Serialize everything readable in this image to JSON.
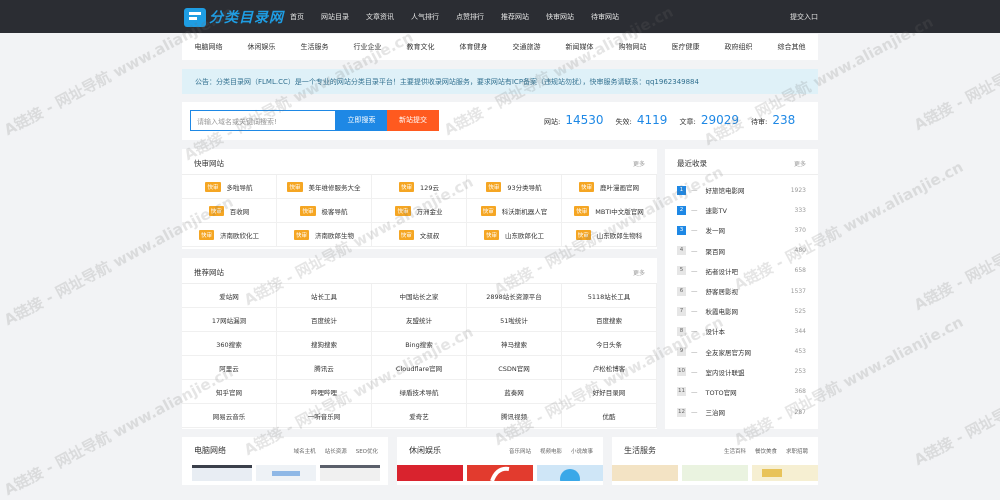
{
  "logo": {
    "text": "分类目录网"
  },
  "topnav": [
    "首页",
    "网站目录",
    "文章资讯",
    "人气排行",
    "点赞排行",
    "推荐网站",
    "快审网站",
    "待审网站"
  ],
  "submit": "提交入口",
  "categories": [
    "电脑网络",
    "休闲娱乐",
    "生活服务",
    "行业企业",
    "教育文化",
    "体育健身",
    "交通旅游",
    "新闻媒体",
    "购物网站",
    "医疗健康",
    "政府组织",
    "综合其他"
  ],
  "notice": "公告：分类目录网（FLML.CC）是一个专业的网站分类目录平台！主要提供收录网站服务，要求网站有ICP备案（违规站勿扰），快审服务请联系：qq1962349884",
  "search": {
    "placeholder": "请输入域名或关键词搜索!",
    "search_btn": "立即搜索",
    "submit_btn": "新站提交"
  },
  "stats": [
    {
      "label": "网站:",
      "value": "14530"
    },
    {
      "label": "失效:",
      "value": "4119"
    },
    {
      "label": "文章:",
      "value": "29029"
    },
    {
      "label": "待审:",
      "value": "238"
    }
  ],
  "fast": {
    "title": "快审网站",
    "more": "更多",
    "tag": "快审",
    "items": [
      "多啦导航",
      "美年维修服务大全",
      "129云",
      "93分类导航",
      "鹿叶漫画官网",
      "百收网",
      "极客导航",
      "万洲金业",
      "科沃斯机器人官",
      "MBTI中文版官网",
      "济南欧欣化工",
      "济南欧郎生物",
      "文叔叔",
      "山东欧郎化工",
      "山东欧郎生物科"
    ]
  },
  "recent": {
    "title": "最近收录",
    "more": "更多",
    "items": [
      {
        "num": "1",
        "name": "好旅馆电影网",
        "count": "1923"
      },
      {
        "num": "2",
        "name": "速影TV",
        "count": "333"
      },
      {
        "num": "3",
        "name": "发一网",
        "count": "370"
      },
      {
        "num": "4",
        "name": "聚百网",
        "count": "480"
      },
      {
        "num": "5",
        "name": "拓者设计吧",
        "count": "658"
      },
      {
        "num": "6",
        "name": "舒客居影视",
        "count": "1537"
      },
      {
        "num": "7",
        "name": "秋霞电影网",
        "count": "525"
      },
      {
        "num": "8",
        "name": "设计本",
        "count": "344"
      },
      {
        "num": "9",
        "name": "全友家居官方网",
        "count": "453"
      },
      {
        "num": "10",
        "name": "室内设计联盟",
        "count": "253"
      },
      {
        "num": "11",
        "name": "TOTO官网",
        "count": "368"
      },
      {
        "num": "12",
        "name": "三治网",
        "count": "287"
      }
    ]
  },
  "recommend": {
    "title": "推荐网站",
    "more": "更多",
    "items": [
      "爱站网",
      "站长工具",
      "中国站长之家",
      "2898站长资源平台",
      "5118站长工具",
      "17网站漏洞",
      "百度统计",
      "友盟统计",
      "51啦统计",
      "百度搜索",
      "360搜索",
      "搜狗搜索",
      "Bing搜索",
      "神马搜索",
      "今日头条",
      "阿里云",
      "腾讯云",
      "Cloudflare官网",
      "CSDN官网",
      "卢松松博客",
      "知乎官网",
      "哔哩哔哩",
      "绿盾技术导航",
      "蓝奏网",
      "好好目录网",
      "网易云音乐",
      "一听音乐网",
      "爱奇艺",
      "腾讯视频",
      "优酷"
    ]
  },
  "bottom": [
    {
      "title": "电脑网络",
      "links": [
        "域名主机",
        "站长资源",
        "SEO优化"
      ]
    },
    {
      "title": "休闲娱乐",
      "links": [
        "音乐网站",
        "视频电影",
        "小说故事"
      ]
    },
    {
      "title": "生活服务",
      "links": [
        "生活百科",
        "餐饮美食",
        "求职招聘"
      ]
    }
  ],
  "watermark": "A链接 - 网址导航 www.alianjie.cn",
  "colors": {
    "accent": "#1e88e5",
    "orange": "#ff5a1f",
    "tag": "#f5a623",
    "topbar": "#2b2d33"
  }
}
